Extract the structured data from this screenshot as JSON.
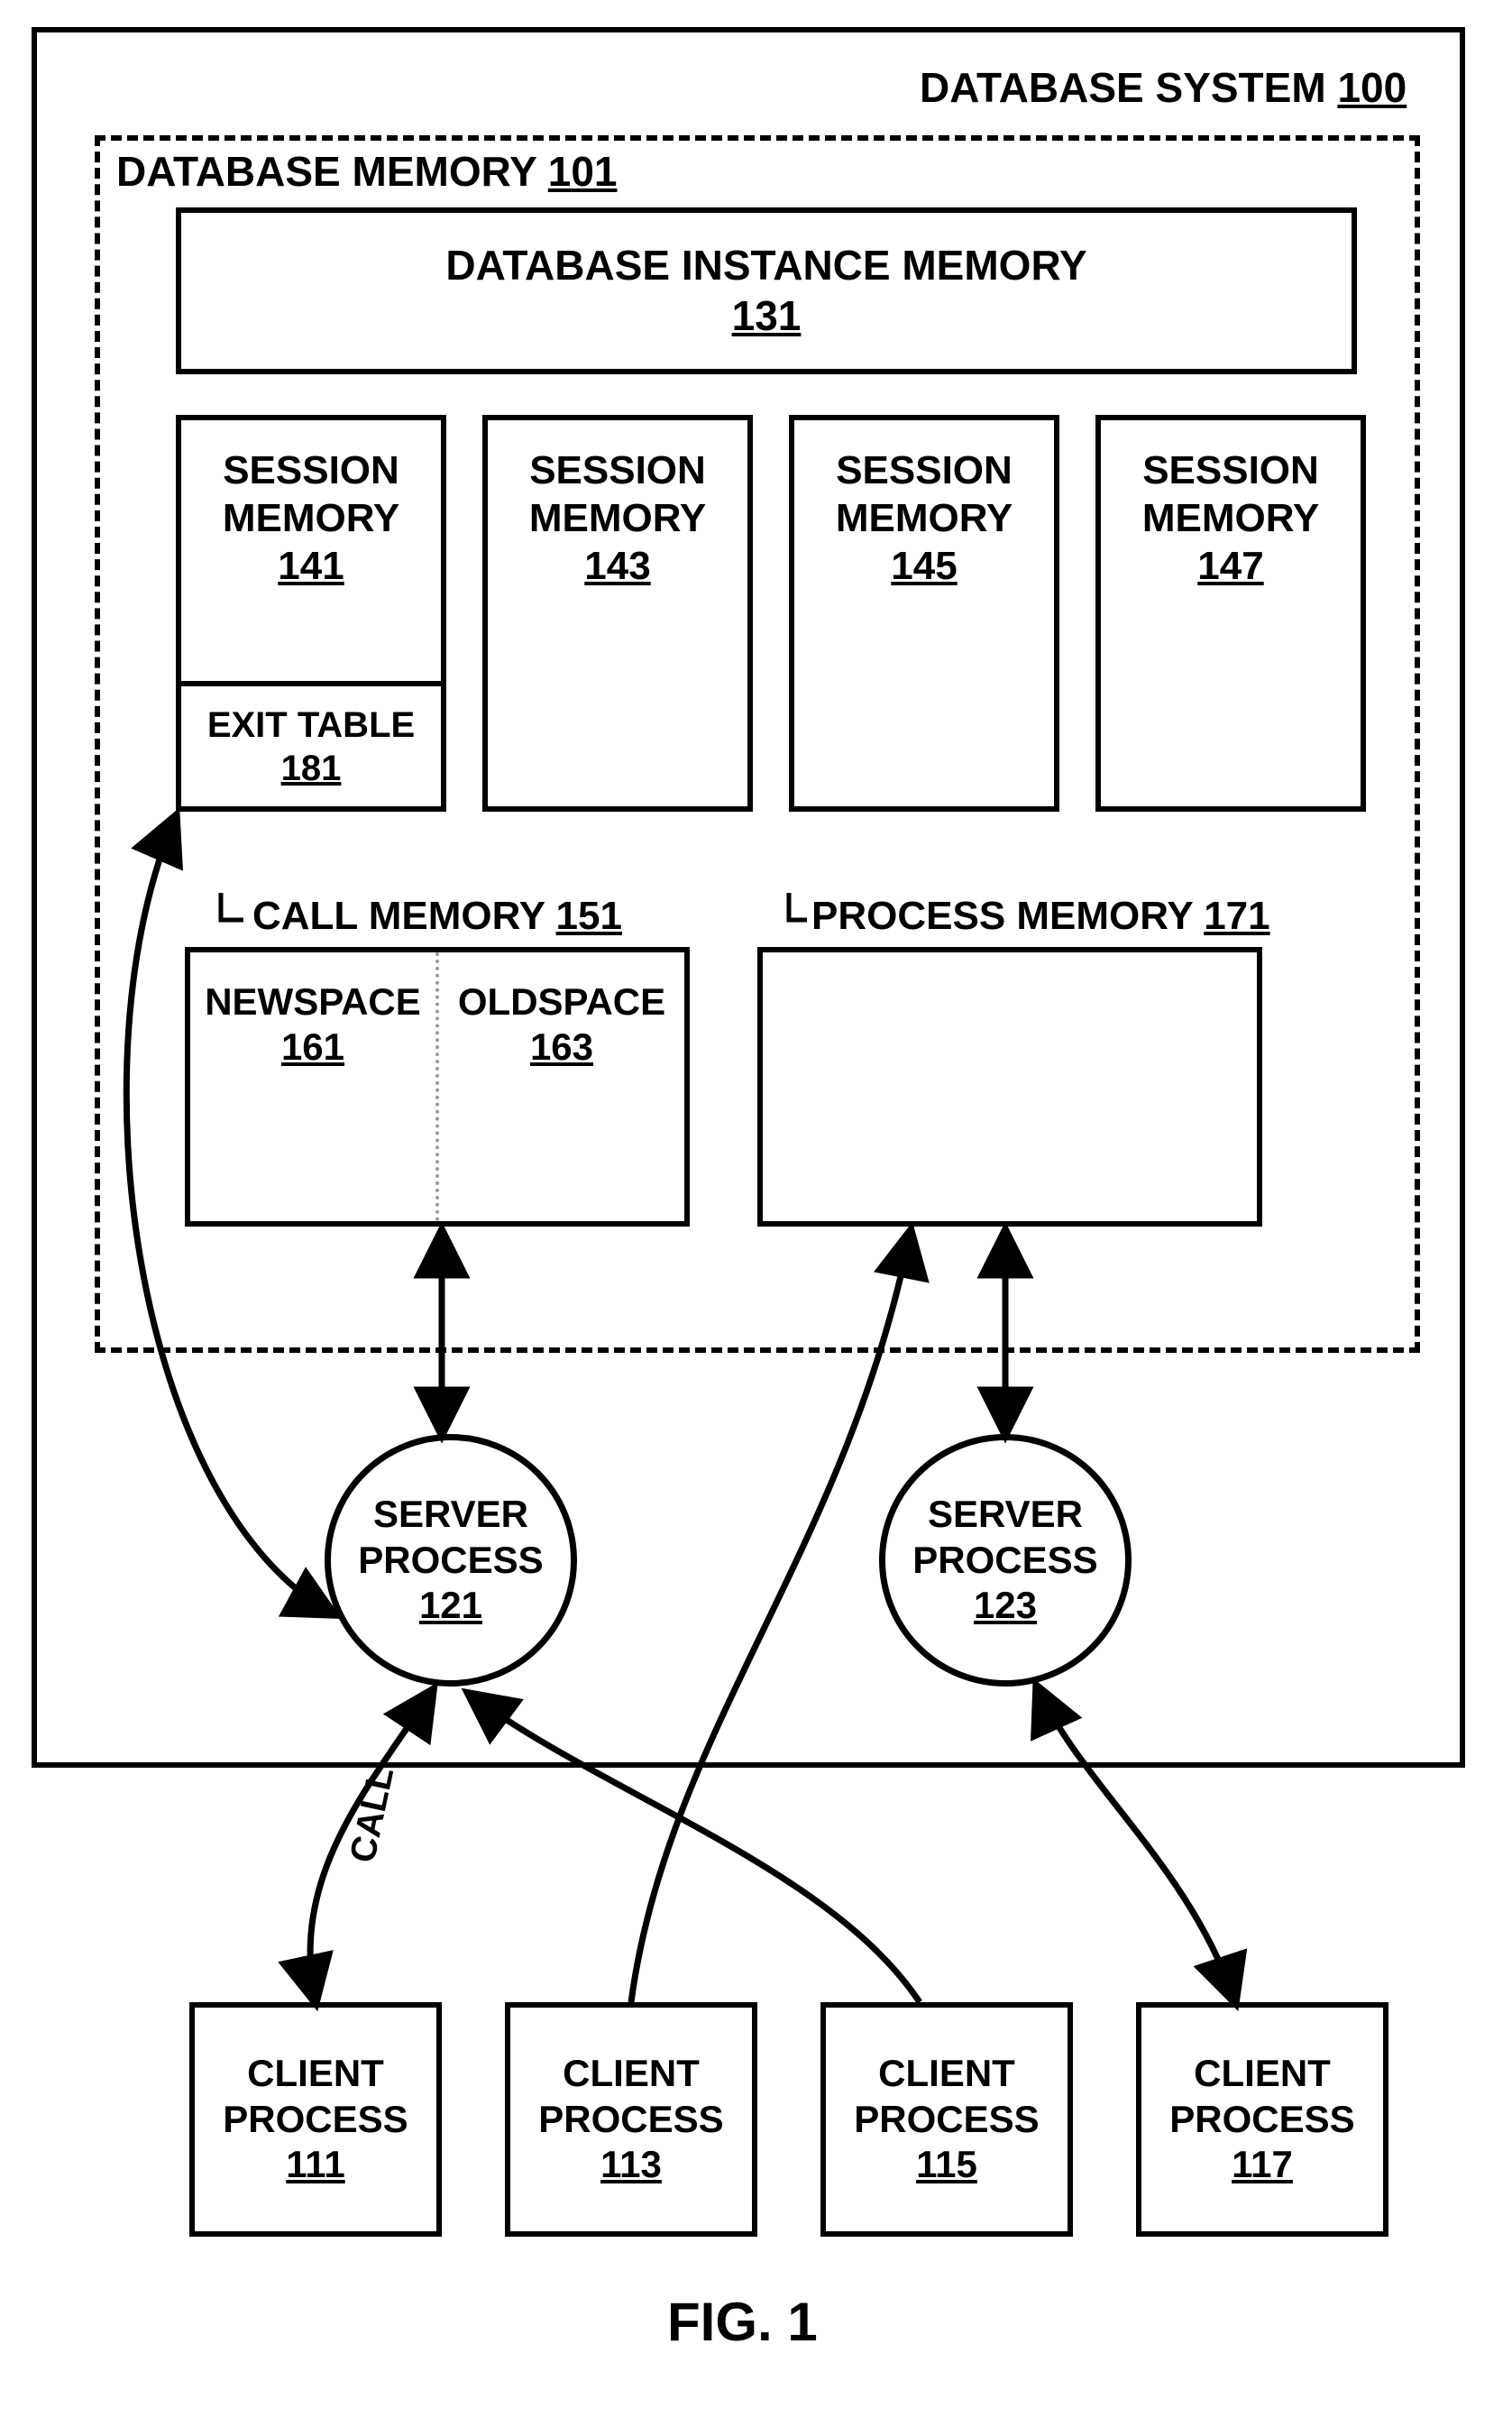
{
  "figure_label": "FIG. 1",
  "system": {
    "title": "DATABASE SYSTEM ",
    "num": "100"
  },
  "db_memory": {
    "title": "DATABASE MEMORY ",
    "num": "101"
  },
  "instance": {
    "title": "DATABASE INSTANCE MEMORY",
    "num": "131"
  },
  "session_memory_label": "SESSION MEMORY",
  "sessions": [
    {
      "num": "141"
    },
    {
      "num": "143"
    },
    {
      "num": "145"
    },
    {
      "num": "147"
    }
  ],
  "exit_table": {
    "title": "EXIT TABLE",
    "num": "181"
  },
  "call_memory": {
    "title": "CALL MEMORY ",
    "num": "151"
  },
  "newspace": {
    "title": "NEWSPACE",
    "num": "161"
  },
  "oldspace": {
    "title": "OLDSPACE",
    "num": "163"
  },
  "process_memory": {
    "title": "PROCESS MEMORY ",
    "num": "171"
  },
  "server_process_label": "SERVER PROCESS",
  "servers": [
    {
      "num": "121"
    },
    {
      "num": "123"
    }
  ],
  "client_process_label": "CLIENT PROCESS",
  "clients": [
    {
      "num": "111"
    },
    {
      "num": "113"
    },
    {
      "num": "115"
    },
    {
      "num": "117"
    }
  ],
  "call_arrow_label": "CALL"
}
